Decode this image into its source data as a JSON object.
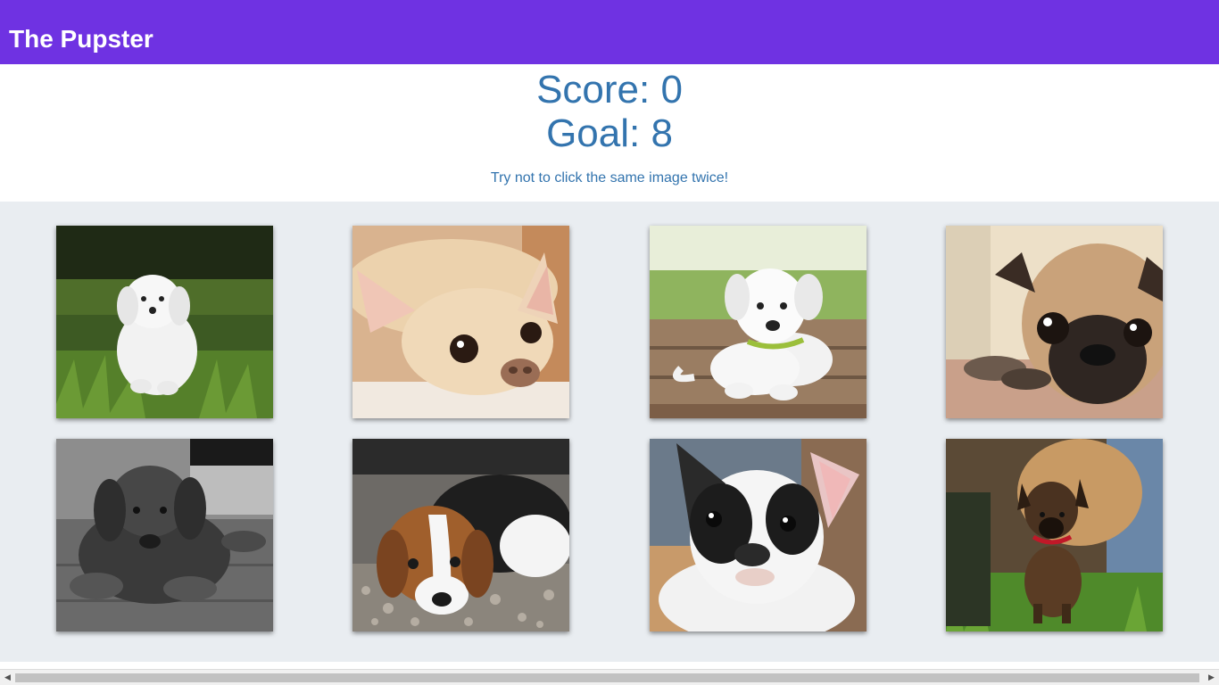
{
  "navbar": {
    "brand": "The Pupster"
  },
  "scoreboard": {
    "score_text": "Score: 0",
    "goal_text": "Goal: 8",
    "hint": "Try not to click the same image twice!"
  },
  "colors": {
    "navbar_bg": "#6f32e2",
    "scoreboard_text": "#3374ae",
    "board_bg": "#e9edf1"
  },
  "cards": [
    {
      "subject": "white maltese puppy sitting in grass"
    },
    {
      "subject": "cream chihuahua lying down"
    },
    {
      "subject": "white labrador puppy on wooden deck"
    },
    {
      "subject": "fawn pug resting on blanket"
    },
    {
      "subject": "grey cane corso puppy lying on floor"
    },
    {
      "subject": "tricolor beagle puppy on gravel"
    },
    {
      "subject": "black and white french bulldog puppy"
    },
    {
      "subject": "malinois puppy with red collar in grass"
    }
  ],
  "scrollbar": {
    "left_arrow": "◀",
    "right_arrow": "▶"
  }
}
